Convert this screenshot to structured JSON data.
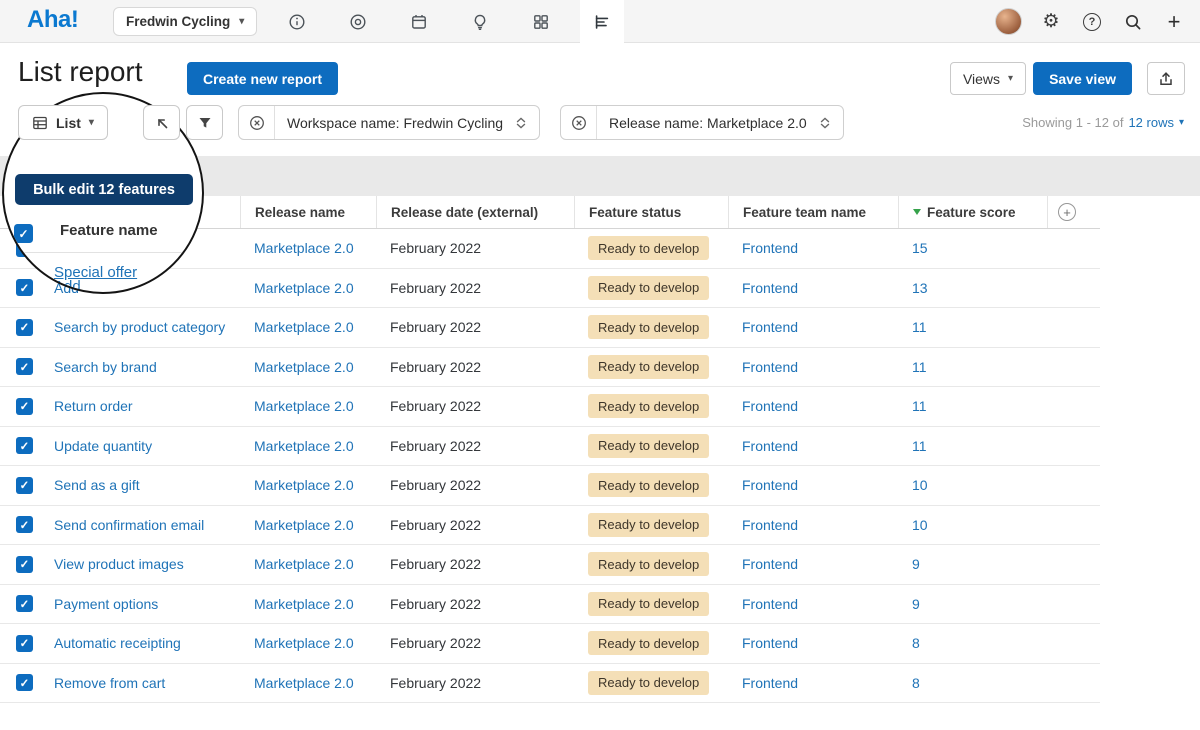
{
  "topbar": {
    "logo": "Aha!",
    "workspace": "Fredwin Cycling"
  },
  "header": {
    "title": "List report",
    "create_report": "Create new report",
    "views": "Views",
    "save_view": "Save view"
  },
  "toolbar": {
    "view_type": "List",
    "chips": [
      {
        "label": "Workspace name: Fredwin Cycling"
      },
      {
        "label": "Release name: Marketplace 2.0"
      }
    ],
    "showing_prefix": "Showing 1 - 12 of",
    "showing_count": "12 rows"
  },
  "magnifier": {
    "bulk_edit": "Bulk edit 12 features",
    "column": "Feature name",
    "row1": "Special offer",
    "row2": "Add"
  },
  "table": {
    "columns": {
      "feature": "Feature name",
      "release": "Release name",
      "date": "Release date (external)",
      "status": "Feature status",
      "team": "Feature team name",
      "score": "Feature score"
    },
    "rows": [
      {
        "feature": "Special offer",
        "release": "Marketplace 2.0",
        "date": "February 2022",
        "status": "Ready to develop",
        "team": "Frontend",
        "score": "15"
      },
      {
        "feature": "Add",
        "release": "Marketplace 2.0",
        "date": "February 2022",
        "status": "Ready to develop",
        "team": "Frontend",
        "score": "13"
      },
      {
        "feature": "Search by product category",
        "release": "Marketplace 2.0",
        "date": "February 2022",
        "status": "Ready to develop",
        "team": "Frontend",
        "score": "11"
      },
      {
        "feature": "Search by brand",
        "release": "Marketplace 2.0",
        "date": "February 2022",
        "status": "Ready to develop",
        "team": "Frontend",
        "score": "11"
      },
      {
        "feature": "Return order",
        "release": "Marketplace 2.0",
        "date": "February 2022",
        "status": "Ready to develop",
        "team": "Frontend",
        "score": "11"
      },
      {
        "feature": "Update quantity",
        "release": "Marketplace 2.0",
        "date": "February 2022",
        "status": "Ready to develop",
        "team": "Frontend",
        "score": "11"
      },
      {
        "feature": "Send as a gift",
        "release": "Marketplace 2.0",
        "date": "February 2022",
        "status": "Ready to develop",
        "team": "Frontend",
        "score": "10"
      },
      {
        "feature": "Send confirmation email",
        "release": "Marketplace 2.0",
        "date": "February 2022",
        "status": "Ready to develop",
        "team": "Frontend",
        "score": "10"
      },
      {
        "feature": "View product images",
        "release": "Marketplace 2.0",
        "date": "February 2022",
        "status": "Ready to develop",
        "team": "Frontend",
        "score": "9"
      },
      {
        "feature": "Payment options",
        "release": "Marketplace 2.0",
        "date": "February 2022",
        "status": "Ready to develop",
        "team": "Frontend",
        "score": "9"
      },
      {
        "feature": "Automatic receipting",
        "release": "Marketplace 2.0",
        "date": "February 2022",
        "status": "Ready to develop",
        "team": "Frontend",
        "score": "8"
      },
      {
        "feature": "Remove from cart",
        "release": "Marketplace 2.0",
        "date": "February 2022",
        "status": "Ready to develop",
        "team": "Frontend",
        "score": "8"
      }
    ]
  },
  "icons": {
    "check": "✓",
    "caret_down": "▾",
    "gear": "⚙",
    "help": "?",
    "plus": "+",
    "add_column": "+"
  },
  "colors": {
    "logo": "#0b79d0",
    "accent": "#0d6cbf",
    "link": "#1f73b7",
    "bulk": "#0e3c6c",
    "badge_bg": "#f4dfb7",
    "badge_text": "#3e362a",
    "sort_green": "#36a24b",
    "band": "#e9e9e9",
    "topbar_bg": "#f5f5f5",
    "row_border": "#e8e8e8"
  }
}
